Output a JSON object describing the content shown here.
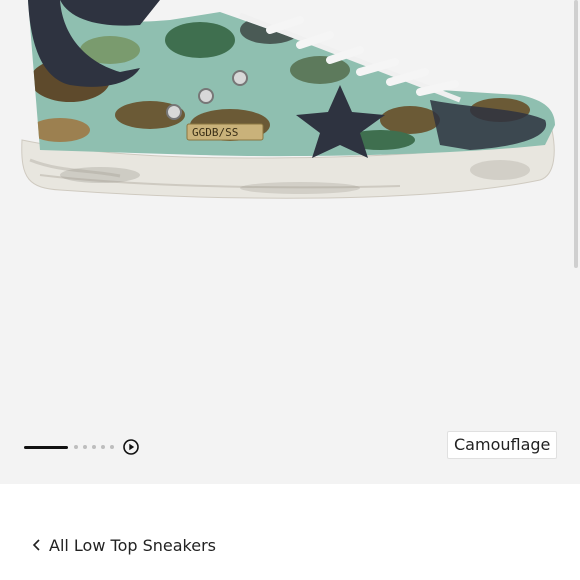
{
  "product": {
    "image_icon": "camouflage-sneaker-image",
    "color_label": "Camouflage",
    "badge_text": "GGDB/SS"
  },
  "gallery": {
    "total_images": 6,
    "current_image": 1,
    "play_icon": "play-circle-icon"
  },
  "breadcrumb": {
    "back_icon": "chevron-left-icon",
    "label": "All Low Top Sneakers"
  },
  "colors": {
    "background": "#f3f3f3",
    "accent": "#111111"
  }
}
